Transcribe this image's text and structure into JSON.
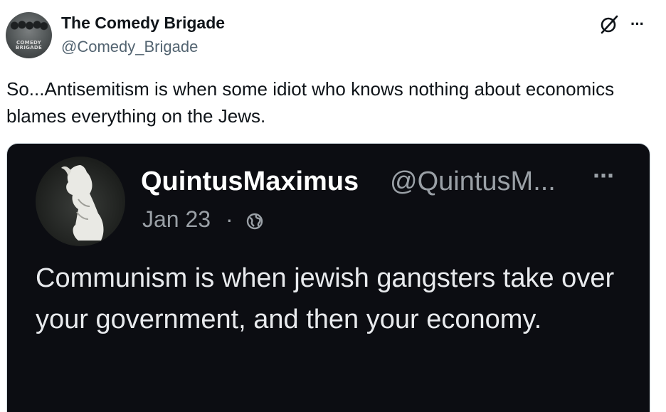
{
  "tweet": {
    "author": {
      "display_name": "The Comedy Brigade",
      "handle": "@Comedy_Brigade",
      "avatar_text_line1": "COMEDY",
      "avatar_text_line2": "BRIGADE"
    },
    "icons": {
      "grok": "grok-icon",
      "more": "more-icon"
    },
    "more_glyph": "···",
    "text": "So...Antisemitism is when some idiot who knows nothing about economics blames everything on the Jews."
  },
  "quoted_screenshot": {
    "display_name": "QuintusMaximus",
    "handle": "@QuintusM...",
    "date": "Jan 23",
    "separator": "·",
    "more_glyph": "···",
    "icons": {
      "globe": "globe-icon",
      "more": "more-icon"
    },
    "text": "Communism is when jewish gangsters take over your government, and then your economy."
  },
  "colors": {
    "text_primary": "#0f1419",
    "text_secondary": "#536471",
    "media_background": "#0c0d12",
    "media_text": "#e8eaed",
    "media_secondary": "#9aa0a6"
  }
}
